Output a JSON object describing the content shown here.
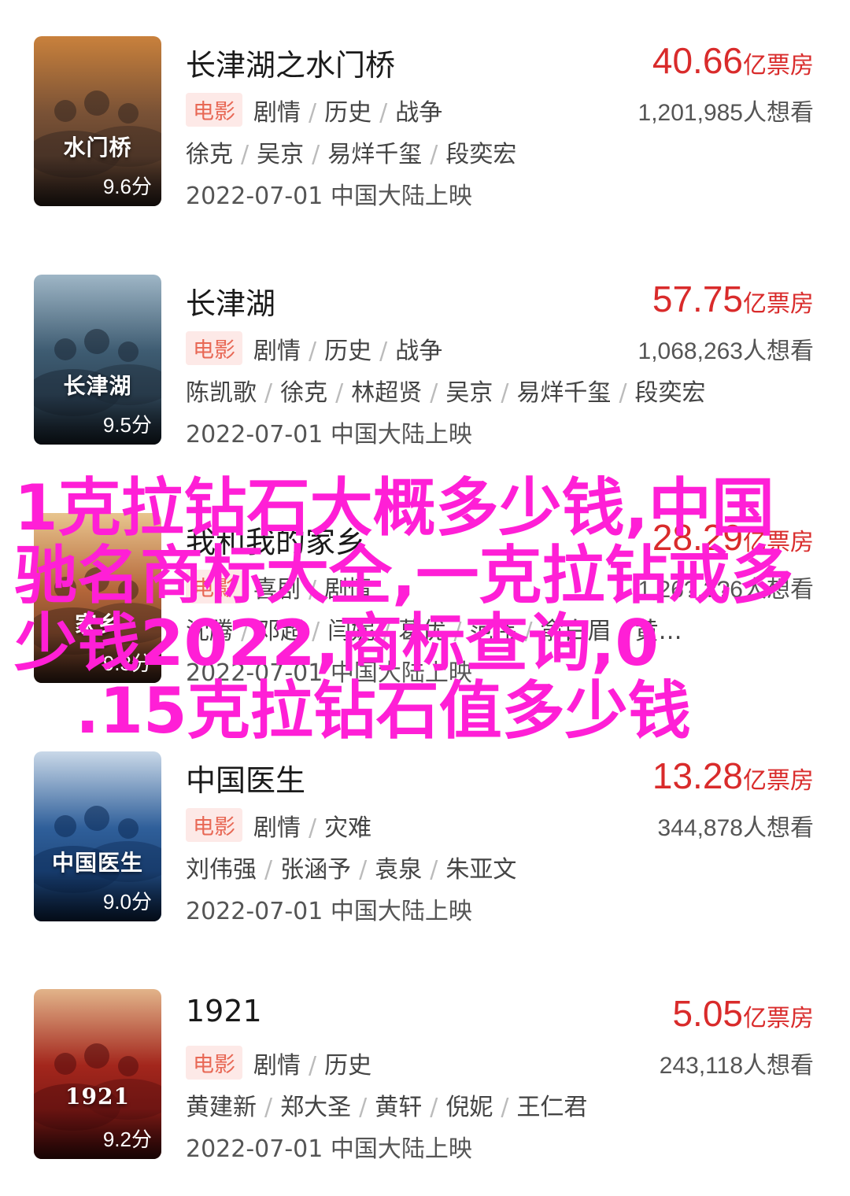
{
  "movies": [
    {
      "title": "长津湖之水门桥",
      "poster_caption": "水门桥",
      "score": "9.6分",
      "box_office": "40.66",
      "box_unit": "亿票房",
      "tag": "电影",
      "genres": [
        "剧情",
        "历史",
        "战争"
      ],
      "want_count": "1,201,985人想看",
      "cast": [
        "徐克",
        "吴京",
        "易烊千玺",
        "段奕宏"
      ],
      "release": "2022-07-01 中国大陆上映"
    },
    {
      "title": "长津湖",
      "poster_caption": "长津湖",
      "score": "9.5分",
      "box_office": "57.75",
      "box_unit": "亿票房",
      "tag": "电影",
      "genres": [
        "剧情",
        "历史",
        "战争"
      ],
      "want_count": "1,068,263人想看",
      "cast": [
        "陈凯歌",
        "徐克",
        "林超贤",
        "吴京",
        "易烊千玺",
        "段奕宏"
      ],
      "release": "2022-07-01 中国大陆上映"
    },
    {
      "title": "我和我的家乡",
      "poster_caption": "家乡",
      "score": "9.3分",
      "box_office": "28.29",
      "box_unit": "亿票房",
      "tag": "电影",
      "genres": [
        "喜剧",
        "剧情"
      ],
      "want_count": "1,26?,??6人想看",
      "cast": [
        "沈腾",
        "邓超",
        "闫妮",
        "葛优",
        "范伟",
        "俞白眉",
        "黄…"
      ],
      "release": "2022-07-01 中国大陆上映"
    },
    {
      "title": "中国医生",
      "poster_caption": "中国医生",
      "score": "9.0分",
      "box_office": "13.28",
      "box_unit": "亿票房",
      "tag": "电影",
      "genres": [
        "剧情",
        "灾难"
      ],
      "want_count": "344,878人想看",
      "cast": [
        "刘伟强",
        "张涵予",
        "袁泉",
        "朱亚文"
      ],
      "release": "2022-07-01 中国大陆上映"
    },
    {
      "title": "1921",
      "poster_caption": "1921",
      "score": "9.2分",
      "box_office": "5.05",
      "box_unit": "亿票房",
      "tag": "电影",
      "genres": [
        "剧情",
        "历史"
      ],
      "want_count": "243,118人想看",
      "cast": [
        "黄建新",
        "郑大圣",
        "黄轩",
        "倪妮",
        "王仁君"
      ],
      "release": "2022-07-01 中国大陆上映"
    }
  ],
  "overlay_text": {
    "line1": "1克拉钻石大概多少钱,中国",
    "line2": "驰名商标大全,一克拉钻戒多",
    "line3": "少钱2022,商标查询,0",
    "line4": ".15克拉钻石值多少钱"
  },
  "colors": {
    "box_office": "#d92b2b",
    "tag_bg": "#fde9e7",
    "tag_text": "#e86855",
    "overlay": "#ff1fd6"
  }
}
